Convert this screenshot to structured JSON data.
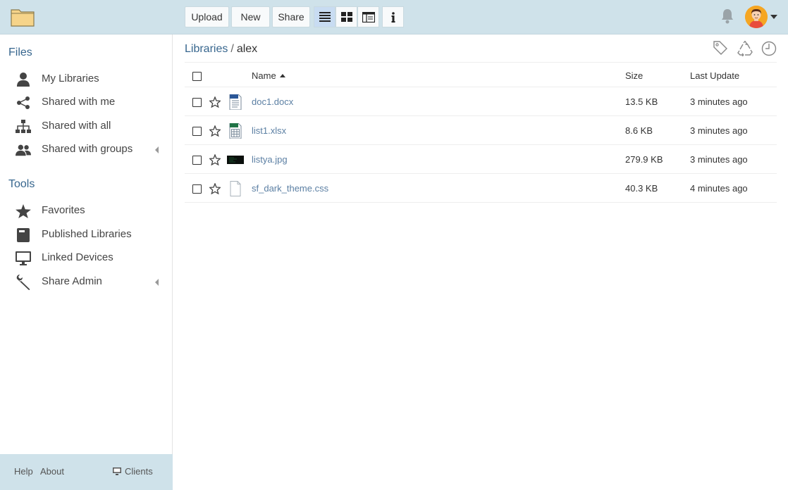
{
  "header": {
    "toolbar": {
      "upload": "Upload",
      "new": "New",
      "share": "Share"
    },
    "view_modes": [
      "list-view-icon",
      "grid-view-icon",
      "column-view-icon"
    ],
    "active_view": "list"
  },
  "sidebar": {
    "files_heading": "Files",
    "files_items": [
      {
        "label": "My Libraries",
        "icon": "user-icon"
      },
      {
        "label": "Shared with me",
        "icon": "share-icon"
      },
      {
        "label": "Shared with all",
        "icon": "org-chart-icon"
      },
      {
        "label": "Shared with groups",
        "icon": "group-icon"
      }
    ],
    "tools_heading": "Tools",
    "tools_items": [
      {
        "label": "Favorites",
        "icon": "star-icon"
      },
      {
        "label": "Published Libraries",
        "icon": "book-icon"
      },
      {
        "label": "Linked Devices",
        "icon": "monitor-icon"
      },
      {
        "label": "Share Admin",
        "icon": "wrench-icon"
      }
    ],
    "footer": {
      "help": "Help",
      "about": "About",
      "clients": "Clients"
    }
  },
  "main": {
    "breadcrumb": {
      "root": "Libraries",
      "separator": "/",
      "current": "alex"
    },
    "table": {
      "headers": {
        "name": "Name",
        "size": "Size",
        "last_update": "Last Update"
      },
      "rows": [
        {
          "name": "doc1.docx",
          "size": "13.5 KB",
          "updated": "3 minutes ago",
          "type": "word"
        },
        {
          "name": "list1.xlsx",
          "size": "8.6 KB",
          "updated": "3 minutes ago",
          "type": "excel"
        },
        {
          "name": "listya.jpg",
          "size": "279.9 KB",
          "updated": "3 minutes ago",
          "type": "image"
        },
        {
          "name": "sf_dark_theme.css",
          "size": "40.3 KB",
          "updated": "4 minutes ago",
          "type": "file"
        }
      ]
    }
  }
}
